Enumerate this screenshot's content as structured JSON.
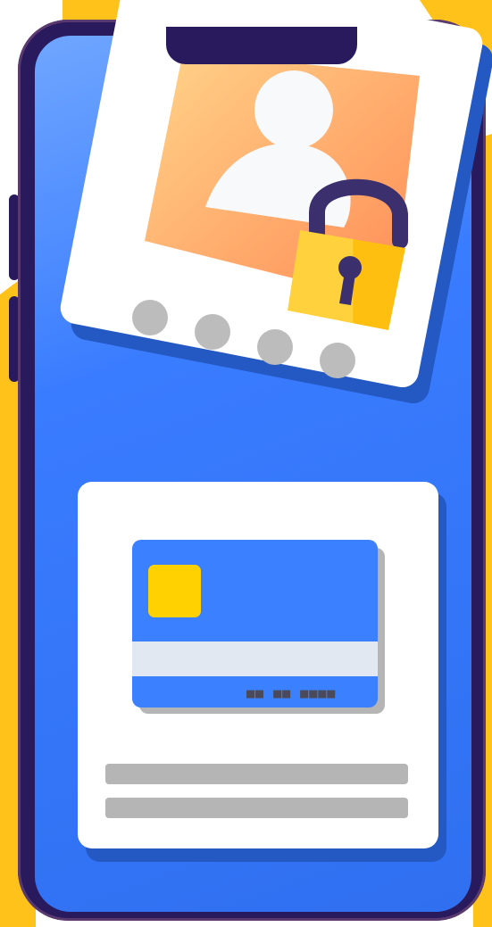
{
  "credit_card": {
    "number_mask": "■■ ■■ ■■■■"
  },
  "profile_card": {
    "indicator_count": 4
  },
  "colors": {
    "screen": "#3a7cff",
    "phone_frame": "#281a5c",
    "accent_yellow": "#ffc21a",
    "card_white": "#ffffff",
    "placeholder_gray": "#bcbcbc",
    "avatar_gradient_start": "#ffd48a",
    "avatar_gradient_end": "#ff8f5a",
    "chip": "#ffd100"
  },
  "icons": [
    "user-avatar-icon",
    "padlock-icon",
    "card-chip-icon"
  ]
}
